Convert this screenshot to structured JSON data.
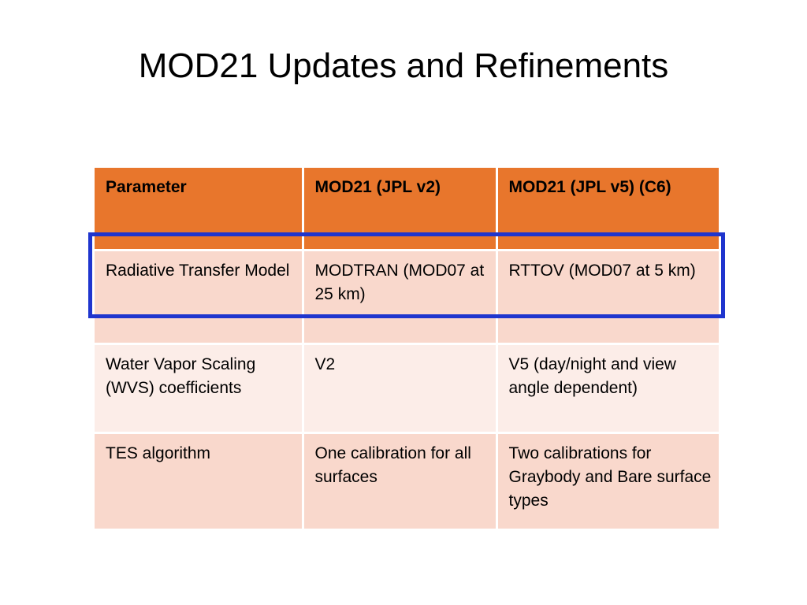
{
  "slide": {
    "title": "MOD21 Updates and Refinements",
    "accent_orange": "#E8762C",
    "row_band_dark": "#F9D8CC",
    "row_band_light": "#FCEDE8",
    "highlight_color": "#1F35CE"
  },
  "table": {
    "headers": [
      "Parameter",
      "MOD21 (JPL v2)",
      "MOD21 (JPL v5) (C6)"
    ],
    "rows": [
      {
        "parameter": "Radiative Transfer Model",
        "v2": "MODTRAN (MOD07 at 25 km)",
        "v5": "RTTOV (MOD07 at 5 km)",
        "highlighted": "true"
      },
      {
        "parameter": "Water Vapor Scaling (WVS) coefficients",
        "v2": "V2",
        "v5": "V5 (day/night and view angle dependent)",
        "highlighted": "false"
      },
      {
        "parameter": "TES algorithm",
        "v2": "One calibration for all surfaces",
        "v5": "Two calibrations for Graybody and Bare surface types",
        "highlighted": "false"
      }
    ]
  }
}
